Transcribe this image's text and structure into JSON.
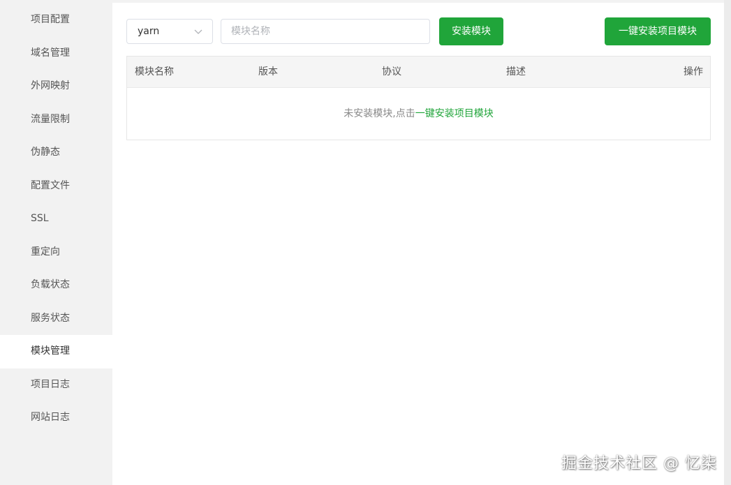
{
  "sidebar": {
    "items": [
      {
        "label": "项目配置",
        "active": false
      },
      {
        "label": "域名管理",
        "active": false
      },
      {
        "label": "外网映射",
        "active": false
      },
      {
        "label": "流量限制",
        "active": false
      },
      {
        "label": "伪静态",
        "active": false
      },
      {
        "label": "配置文件",
        "active": false
      },
      {
        "label": "SSL",
        "active": false
      },
      {
        "label": "重定向",
        "active": false
      },
      {
        "label": "负载状态",
        "active": false
      },
      {
        "label": "服务状态",
        "active": false
      },
      {
        "label": "模块管理",
        "active": true
      },
      {
        "label": "项目日志",
        "active": false
      },
      {
        "label": "网站日志",
        "active": false
      }
    ]
  },
  "toolbar": {
    "package_manager": "yarn",
    "search_placeholder": "模块名称",
    "search_value": "",
    "install_label": "安装模块",
    "install_all_label": "一键安装项目模块"
  },
  "table": {
    "columns": [
      "模块名称",
      "版本",
      "协议",
      "描述",
      "操作"
    ],
    "rows": [],
    "empty_prefix": "未安装模块,点击",
    "empty_link": "一键安装项目模块"
  },
  "watermark": "掘金技术社区 @ 忆柒",
  "colors": {
    "accent": "#20a53a",
    "sidebar_bg": "#f2f2f2",
    "header_bg": "#f5f5f5"
  }
}
